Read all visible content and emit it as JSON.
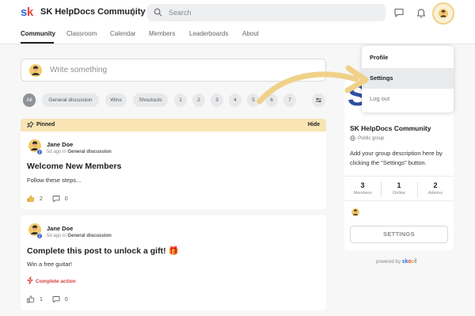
{
  "header": {
    "logo_text_s": "s",
    "logo_text_k": "k",
    "community_name": "SK HelpDocs Community",
    "search_placeholder": "Search"
  },
  "nav": {
    "tabs": [
      {
        "label": "Community",
        "active": true
      },
      {
        "label": "Classroom"
      },
      {
        "label": "Calendar"
      },
      {
        "label": "Members"
      },
      {
        "label": "Leaderboards"
      },
      {
        "label": "About"
      }
    ]
  },
  "composer": {
    "placeholder": "Write something"
  },
  "filters": {
    "chips": [
      "All",
      "General discussion",
      "Wins",
      "Shoutouts"
    ],
    "pages": [
      "1",
      "2",
      "3",
      "4",
      "5",
      "6",
      "7"
    ]
  },
  "pinned": {
    "label": "Pinned",
    "hide": "Hide"
  },
  "posts": [
    {
      "author": "Jane Doe",
      "level": "2",
      "time": "5d ago in",
      "category": "General discussion",
      "title": "Welcome New Members",
      "body": "Follow these steps...",
      "likes": "2",
      "comments": "0"
    },
    {
      "author": "Jane Doe",
      "level": "2",
      "time": "5d ago in",
      "category": "General discussion",
      "title": "Complete this post to unlock a gift! 🎁",
      "body": "Win a free guitar!",
      "action": "Complete action",
      "likes": "1",
      "comments": "0"
    }
  ],
  "group": {
    "banner_letter": "S",
    "name": "SK HelpDocs Community",
    "type": "Public group",
    "description": "Add your group description here by clicking the \"Settings\" button.",
    "stats": [
      {
        "value": "3",
        "label": "Members"
      },
      {
        "value": "1",
        "label": "Online"
      },
      {
        "value": "2",
        "label": "Admins"
      }
    ],
    "settings_label": "SETTINGS"
  },
  "powered": {
    "text": "powered by",
    "brand": "skool"
  },
  "dropdown": {
    "items": [
      {
        "label": "Profile"
      },
      {
        "label": "Settings",
        "highlighted": true
      },
      {
        "label": "Log out"
      }
    ]
  },
  "colors": {
    "accent_yellow": "#f0d189",
    "pinned_bg": "#f8e4b4",
    "action_red": "#d6403a",
    "logo_blue": "#2e6fd6",
    "logo_red": "#e4433a"
  }
}
